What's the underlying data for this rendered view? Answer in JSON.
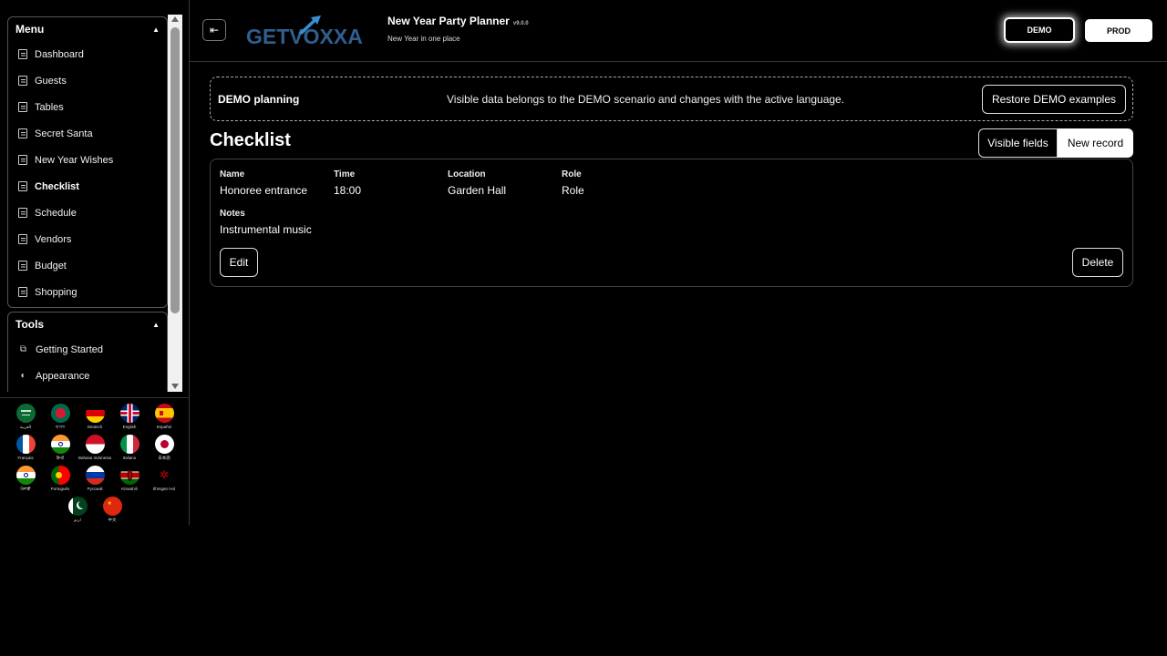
{
  "sidebar": {
    "menu": {
      "title": "Menu",
      "items": [
        {
          "label": "Dashboard"
        },
        {
          "label": "Guests"
        },
        {
          "label": "Tables"
        },
        {
          "label": "Secret Santa"
        },
        {
          "label": "New Year Wishes"
        },
        {
          "label": "Checklist",
          "active": true
        },
        {
          "label": "Schedule"
        },
        {
          "label": "Vendors"
        },
        {
          "label": "Budget"
        },
        {
          "label": "Shopping"
        }
      ]
    },
    "tools": {
      "title": "Tools",
      "items": [
        {
          "label": "Getting Started"
        },
        {
          "label": "Appearance"
        }
      ]
    },
    "languages": [
      {
        "label": "العربية"
      },
      {
        "label": "বাংলা"
      },
      {
        "label": "Deutsch"
      },
      {
        "label": "English"
      },
      {
        "label": "Español"
      },
      {
        "label": "Français"
      },
      {
        "label": "हिन्दी"
      },
      {
        "label": "Bahasa Indonesia"
      },
      {
        "label": "Italiano"
      },
      {
        "label": "日本語"
      },
      {
        "label": "ਪੰਜਾਬੀ"
      },
      {
        "label": "Português"
      },
      {
        "label": "Русский"
      },
      {
        "label": "Kiswahili"
      },
      {
        "label": "tlhIngan Hol"
      },
      {
        "label": "اردو"
      },
      {
        "label": "中文"
      }
    ]
  },
  "header": {
    "logo_text": "GETVOXXA",
    "title": "New Year Party Planner",
    "version": "v9.0.0",
    "subtitle": "New Year in one place",
    "demo_label": "DEMO",
    "prod_label": "PROD"
  },
  "banner": {
    "title": "DEMO planning",
    "text": "Visible data belongs to the DEMO scenario and changes with the active language.",
    "restore_label": "Restore DEMO examples"
  },
  "main": {
    "title": "Checklist",
    "visible_fields_label": "Visible fields",
    "new_record_label": "New record",
    "record": {
      "name_label": "Name",
      "name_value": "Honoree entrance",
      "time_label": "Time",
      "time_value": "18:00",
      "location_label": "Location",
      "location_value": "Garden Hall",
      "role_label": "Role",
      "role_value": "Role",
      "notes_label": "Notes",
      "notes_value": "Instrumental music",
      "edit_label": "Edit",
      "delete_label": "Delete"
    }
  }
}
